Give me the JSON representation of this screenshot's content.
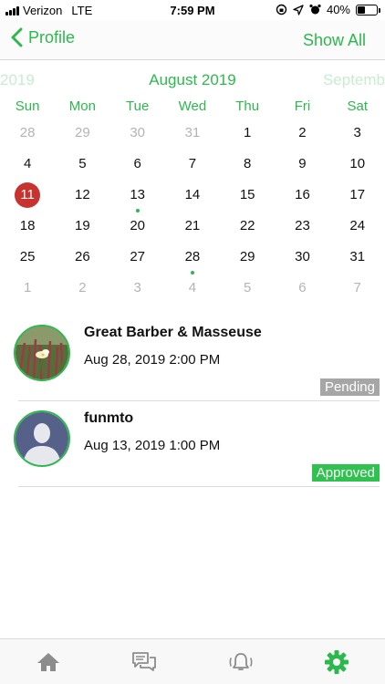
{
  "status_bar": {
    "carrier": "Verizon",
    "network": "LTE",
    "time": "7:59 PM",
    "battery": "40%",
    "battery_level": 0.4
  },
  "nav": {
    "back_label": "Profile",
    "right_action": "Show All"
  },
  "calendar": {
    "prev_month": "2019",
    "current_month": "August 2019",
    "next_month": "Septemb",
    "weekdays": [
      "Sun",
      "Mon",
      "Tue",
      "Wed",
      "Thu",
      "Fri",
      "Sat"
    ],
    "weeks": [
      [
        {
          "d": "28",
          "m": true
        },
        {
          "d": "29",
          "m": true
        },
        {
          "d": "30",
          "m": true
        },
        {
          "d": "31",
          "m": true
        },
        {
          "d": "1"
        },
        {
          "d": "2"
        },
        {
          "d": "3"
        }
      ],
      [
        {
          "d": "4"
        },
        {
          "d": "5"
        },
        {
          "d": "6"
        },
        {
          "d": "7"
        },
        {
          "d": "8"
        },
        {
          "d": "9"
        },
        {
          "d": "10"
        }
      ],
      [
        {
          "d": "11",
          "today": true
        },
        {
          "d": "12"
        },
        {
          "d": "13",
          "event": true
        },
        {
          "d": "14"
        },
        {
          "d": "15"
        },
        {
          "d": "16"
        },
        {
          "d": "17"
        }
      ],
      [
        {
          "d": "18"
        },
        {
          "d": "19"
        },
        {
          "d": "20"
        },
        {
          "d": "21"
        },
        {
          "d": "22"
        },
        {
          "d": "23"
        },
        {
          "d": "24"
        }
      ],
      [
        {
          "d": "25"
        },
        {
          "d": "26"
        },
        {
          "d": "27"
        },
        {
          "d": "28",
          "event": true
        },
        {
          "d": "29"
        },
        {
          "d": "30"
        },
        {
          "d": "31"
        }
      ],
      [
        {
          "d": "1",
          "m": true
        },
        {
          "d": "2",
          "m": true
        },
        {
          "d": "3",
          "m": true
        },
        {
          "d": "4",
          "m": true
        },
        {
          "d": "5",
          "m": true
        },
        {
          "d": "6",
          "m": true
        },
        {
          "d": "7",
          "m": true
        }
      ]
    ]
  },
  "appointments": [
    {
      "name": "Great Barber & Masseuse",
      "datetime": "Aug 28, 2019 2:00 PM",
      "status": "Pending",
      "avatar": "flower-photo"
    },
    {
      "name": "funmto",
      "datetime": "Aug 13, 2019 1:00 PM",
      "status": "Approved",
      "avatar": "default-person"
    }
  ],
  "tab_bar": {
    "tabs": [
      {
        "icon": "home-icon",
        "active": false
      },
      {
        "icon": "chat-icon",
        "active": false
      },
      {
        "icon": "bell-icon",
        "active": false
      },
      {
        "icon": "gear-icon",
        "active": true
      }
    ]
  },
  "colors": {
    "accent": "#2db84d",
    "today": "#c7332e",
    "pending": "#a6a6a6",
    "approved": "#2fc24f"
  }
}
